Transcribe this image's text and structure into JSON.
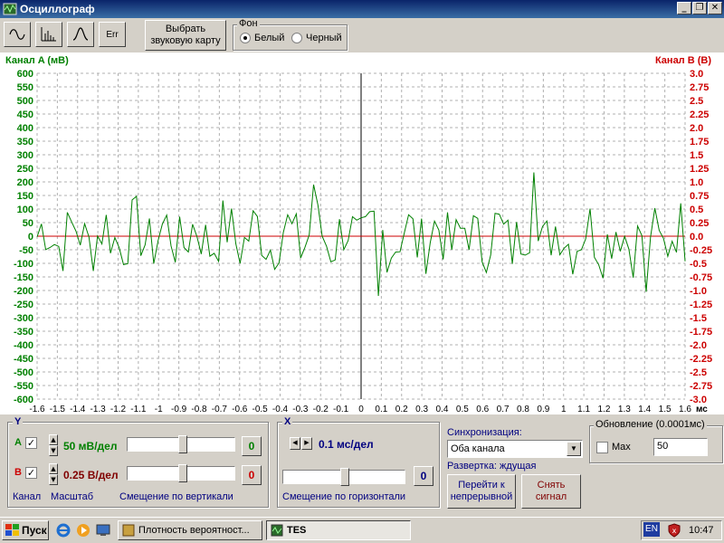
{
  "window": {
    "title": "Осциллограф"
  },
  "toolbar": {
    "select_card_label": "Выбрать звуковую карту",
    "background": {
      "legend": "Фон",
      "white": "Белый",
      "black": "Черный",
      "selected": "white"
    },
    "err_label": "Err"
  },
  "scope": {
    "channel_a_title": "Канал A (мВ)",
    "channel_b_title": "Канал B (В)",
    "left_ticks": [
      "600",
      "550",
      "500",
      "450",
      "400",
      "350",
      "300",
      "250",
      "200",
      "150",
      "100",
      "50",
      "0",
      "-50",
      "-100",
      "-150",
      "-200",
      "-250",
      "-300",
      "-350",
      "-400",
      "-450",
      "-500",
      "-550",
      "-600"
    ],
    "right_ticks": [
      "3.0",
      "2.75",
      "2.5",
      "2.25",
      "2.0",
      "1.75",
      "1.5",
      "1.25",
      "1.0",
      "0.75",
      "0.5",
      "0.25",
      "0.0",
      "-0.25",
      "-0.5",
      "-0.75",
      "-1.0",
      "-1.25",
      "-1.5",
      "-1.75",
      "-2.0",
      "-2.25",
      "-2.5",
      "-2.75",
      "-3.0"
    ],
    "x_ticks": [
      "-1.6",
      "-1.5",
      "-1.4",
      "-1.3",
      "-1.2",
      "-1.1",
      "-1",
      "-0.9",
      "-0.8",
      "-0.7",
      "-0.6",
      "-0.5",
      "-0.4",
      "-0.3",
      "-0.2",
      "-0.1",
      "0",
      "0.1",
      "0.2",
      "0.3",
      "0.4",
      "0.5",
      "0.6",
      "0.7",
      "0.8",
      "0.9",
      "1",
      "1.1",
      "1.2",
      "1.3",
      "1.4",
      "1.5",
      "1.6"
    ],
    "x_unit": "мс",
    "colors": {
      "channel_a": "#008000",
      "channel_b": "#cc0000"
    }
  },
  "y_panel": {
    "legend": "Y",
    "channel_a_label": "A",
    "channel_b_label": "B",
    "scale_a": "50 мВ/дел",
    "scale_b": "0.25 В/дел",
    "offset_a": "0",
    "offset_b": "0",
    "footer_channel": "Канал",
    "footer_scale": "Масштаб",
    "footer_offset": "Смещение по вертикали"
  },
  "x_panel": {
    "legend": "X",
    "timebase": "0.1 мс/дел",
    "offset": "0",
    "footer_offset": "Смещение по горизонтали"
  },
  "sync": {
    "label": "Синхронизация:",
    "mode": "Оба канала",
    "sweep": "Развертка: ждущая",
    "continuous_label": "Перейти к непрерывной",
    "capture_label": "Снять сигнал"
  },
  "update": {
    "legend": "Обновление (0.0001мс)",
    "max_label": "Max",
    "value": "50"
  },
  "taskbar": {
    "start": "Пуск",
    "task1": "Плотность вероятност...",
    "task2": "TES",
    "lang": "EN",
    "time": "10:47"
  }
}
